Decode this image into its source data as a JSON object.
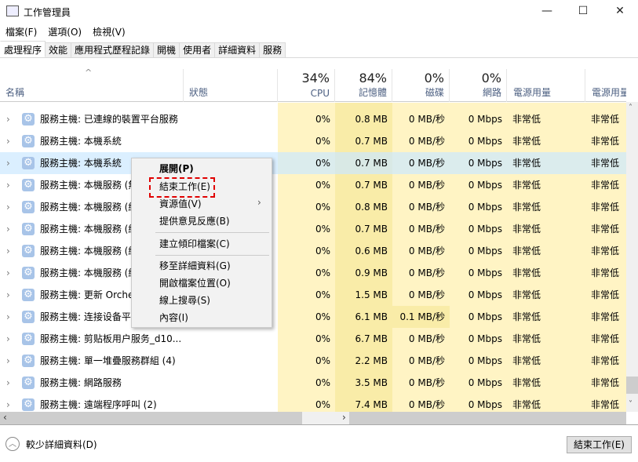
{
  "window": {
    "title": "工作管理員",
    "minimize": "—",
    "maximize": "☐",
    "close": "✕"
  },
  "menu": [
    "檔案(F)",
    "選項(O)",
    "檢視(V)"
  ],
  "tabs": [
    "處理程序",
    "效能",
    "應用程式歷程記錄",
    "開機",
    "使用者",
    "詳細資料",
    "服務"
  ],
  "header": {
    "name": "名稱",
    "status": "狀態",
    "cpu_pct": "34%",
    "cpu": "CPU",
    "mem_pct": "84%",
    "mem": "記憶體",
    "disk_pct": "0%",
    "disk": "磁碟",
    "net_pct": "0%",
    "net": "網路",
    "power": "電源用量",
    "power_trend": "電源用量趨勢"
  },
  "rows": [
    {
      "name": "服務主機: 已連線的裝置平台服務",
      "cpu": "0%",
      "mem": "0.8 MB",
      "disk": "0 MB/秒",
      "net": "0 Mbps",
      "power": "非常低",
      "trend": "非常低"
    },
    {
      "name": "服務主機: 本機系統",
      "cpu": "0%",
      "mem": "0.7 MB",
      "disk": "0 MB/秒",
      "net": "0 Mbps",
      "power": "非常低",
      "trend": "非常低"
    },
    {
      "name": "服務主機: 本機系統",
      "cpu": "0%",
      "mem": "0.7 MB",
      "disk": "0 MB/秒",
      "net": "0 Mbps",
      "power": "非常低",
      "trend": "非常低",
      "selected": true
    },
    {
      "name": "服務主機: 本機服務 (無",
      "cpu": "0%",
      "mem": "0.7 MB",
      "disk": "0 MB/秒",
      "net": "0 Mbps",
      "power": "非常低",
      "trend": "非常低"
    },
    {
      "name": "服務主機: 本機服務 (網",
      "cpu": "0%",
      "mem": "0.8 MB",
      "disk": "0 MB/秒",
      "net": "0 Mbps",
      "power": "非常低",
      "trend": "非常低"
    },
    {
      "name": "服務主機: 本機服務 (網",
      "cpu": "0%",
      "mem": "0.7 MB",
      "disk": "0 MB/秒",
      "net": "0 Mbps",
      "power": "非常低",
      "trend": "非常低"
    },
    {
      "name": "服務主機: 本機服務 (網",
      "cpu": "0%",
      "mem": "0.6 MB",
      "disk": "0 MB/秒",
      "net": "0 Mbps",
      "power": "非常低",
      "trend": "非常低"
    },
    {
      "name": "服務主機: 本機服務 (網",
      "cpu": "0%",
      "mem": "0.9 MB",
      "disk": "0 MB/秒",
      "net": "0 Mbps",
      "power": "非常低",
      "trend": "非常低"
    },
    {
      "name": "服務主機: 更新 Orches",
      "cpu": "0%",
      "mem": "1.5 MB",
      "disk": "0 MB/秒",
      "net": "0 Mbps",
      "power": "非常低",
      "trend": "非常低"
    },
    {
      "name": "服務主機: 连接设备平台",
      "cpu": "0%",
      "mem": "6.1 MB",
      "disk": "0.1 MB/秒",
      "net": "0 Mbps",
      "power": "非常低",
      "trend": "非常低"
    },
    {
      "name": "服務主機: 剪贴板用户服务_d10...",
      "cpu": "0%",
      "mem": "6.7 MB",
      "disk": "0 MB/秒",
      "net": "0 Mbps",
      "power": "非常低",
      "trend": "非常低"
    },
    {
      "name": "服務主機: 單一堆疊服務群組 (4)",
      "cpu": "0%",
      "mem": "2.2 MB",
      "disk": "0 MB/秒",
      "net": "0 Mbps",
      "power": "非常低",
      "trend": "非常低"
    },
    {
      "name": "服務主機: 網路服務",
      "cpu": "0%",
      "mem": "3.5 MB",
      "disk": "0 MB/秒",
      "net": "0 Mbps",
      "power": "非常低",
      "trend": "非常低"
    },
    {
      "name": "服務主機: 遠端程序呼叫 (2)",
      "cpu": "0%",
      "mem": "7.4 MB",
      "disk": "0 MB/秒",
      "net": "0 Mbps",
      "power": "非常低",
      "trend": "非常低"
    }
  ],
  "context_menu": {
    "expand": "展開(P)",
    "end_task": "結束工作(E)",
    "resource_values": "資源值(V)",
    "feedback": "提供意見反應(B)",
    "dump": "建立傾印檔案(C)",
    "details": "移至詳細資料(G)",
    "open_location": "開啟檔案位置(O)",
    "search_online": "線上搜尋(S)",
    "properties": "內容(I)"
  },
  "footer": {
    "fewer_details": "較少詳細資料(D)",
    "end_task": "結束工作(E)"
  },
  "colors": {
    "cpu_bg": "#fff4c4",
    "mem_bg": "#f9eca8",
    "selected": "#cce8ff",
    "highlight": "#e00000"
  }
}
